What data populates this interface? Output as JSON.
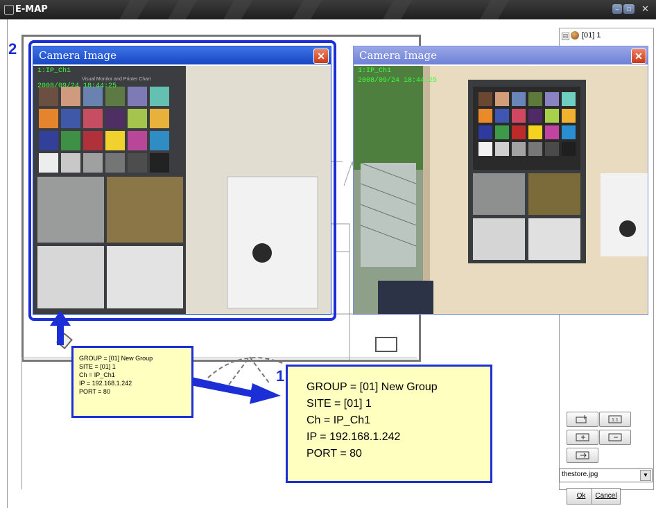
{
  "window": {
    "title": "E-MAP"
  },
  "tree": {
    "root_label": "[01] 1",
    "expander": "⊟"
  },
  "sidebar": {
    "select_value": "thestore.jpg",
    "ok_label": "Ok",
    "cancel_label": "Cancel"
  },
  "camera_windows": [
    {
      "title": "Camera Image",
      "channel_overlay": "1:IP_Ch1",
      "timestamp_overlay": "2008/09/24  18:44:25",
      "poster_text": "Visual Monitor and Printer Chart"
    },
    {
      "title": "Camera Image",
      "channel_overlay": "1:IP_Ch1",
      "timestamp_overlay": "2008/09/24  18:44:25"
    }
  ],
  "small_tooltip": {
    "group": "GROUP = [01] New Group",
    "site": "SITE = [01] 1",
    "ch": "Ch = IP_Ch1",
    "ip": "IP = 192.168.1.242",
    "port": "PORT = 80"
  },
  "large_tooltip": {
    "group": "GROUP = [01] New Group",
    "site": "SITE = [01] 1",
    "ch": "Ch = IP_Ch1",
    "ip": "IP = 192.168.1.242",
    "port": "PORT = 80"
  },
  "annotations": {
    "callout_1": "1",
    "callout_2": "2"
  },
  "colors": {
    "annotation_blue": "#1c2fd6",
    "tooltip_bg": "#ffffc0",
    "camera_title_active": "#1f4fd8",
    "camera_title_inactive": "#7d8ed8",
    "overlay_green": "#3cff3c"
  }
}
